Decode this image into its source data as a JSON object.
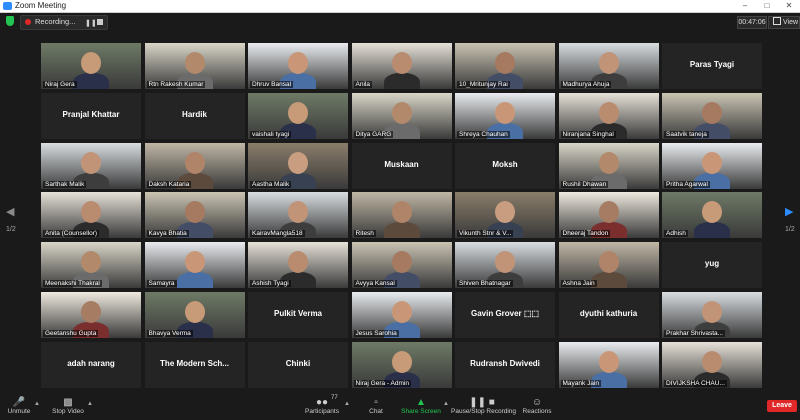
{
  "window": {
    "title": "Zoom Meeting"
  },
  "recording": {
    "label": "Recording...",
    "pause_icon": "pause-icon",
    "stop_icon": "stop-icon"
  },
  "meeting": {
    "elapsed": "00:47:06",
    "view_label": "View"
  },
  "pager": {
    "left_page": "1/2",
    "right_page": "1/2"
  },
  "participants": [
    {
      "name": "Niraj Gera",
      "video": true
    },
    {
      "name": "Rtn Rakesh Kumar",
      "video": true
    },
    {
      "name": "Dhruv Bansal",
      "video": true
    },
    {
      "name": "Anila",
      "video": true
    },
    {
      "name": "10_Mritunjay Rai",
      "video": true
    },
    {
      "name": "Madhurya Ahuja",
      "video": true
    },
    {
      "name": "Paras Tyagi",
      "video": false
    },
    {
      "name": "Pranjal Khattar",
      "video": false
    },
    {
      "name": "Hardik",
      "video": false
    },
    {
      "name": "vaishali tyagi",
      "video": true
    },
    {
      "name": "Ditya GARG",
      "video": true
    },
    {
      "name": "Shreya Chauhan",
      "video": true
    },
    {
      "name": "Niranjana Singhal",
      "video": true
    },
    {
      "name": "Saatvik taneja",
      "video": true
    },
    {
      "name": "Sarthak Malik",
      "video": true
    },
    {
      "name": "Daksh Kataria",
      "video": true
    },
    {
      "name": "Aastha Malik",
      "video": true
    },
    {
      "name": "Muskaan",
      "video": false
    },
    {
      "name": "Moksh",
      "video": false
    },
    {
      "name": "Rushil Dhawan",
      "video": true
    },
    {
      "name": "Pritha Agarwal",
      "video": true
    },
    {
      "name": "Anita (Counsellor)",
      "video": true
    },
    {
      "name": "Kavya Bhatia",
      "video": true
    },
    {
      "name": "KairavMangla518",
      "video": true
    },
    {
      "name": "Ritesh",
      "video": true
    },
    {
      "name": "Vikunth Stnr & V...",
      "video": true
    },
    {
      "name": "Dheeraj Tandon",
      "video": true
    },
    {
      "name": "Adhish",
      "video": true
    },
    {
      "name": "Meenakshi Thakral",
      "video": true
    },
    {
      "name": "Samayra",
      "video": true
    },
    {
      "name": "Ashish Tyagi",
      "video": true
    },
    {
      "name": "Avyya Kansal",
      "video": true
    },
    {
      "name": "Shiven Bhatnagar",
      "video": true
    },
    {
      "name": "Ashna Jain",
      "video": true
    },
    {
      "name": "yug",
      "video": false
    },
    {
      "name": "Geetanshu Gupta",
      "video": true
    },
    {
      "name": "Bhavya Verma",
      "video": true
    },
    {
      "name": "Pulkit Verma",
      "video": false
    },
    {
      "name": "Jesus Sarohia",
      "video": true
    },
    {
      "name": "Gavin Grover ⬚⬚",
      "video": false
    },
    {
      "name": "dyuthi kathuria",
      "video": false
    },
    {
      "name": "Prakhar Shrivasta...",
      "video": true
    },
    {
      "name": "adah narang",
      "video": false
    },
    {
      "name": "The Modern Sch...",
      "video": false
    },
    {
      "name": "Chinki",
      "video": false
    },
    {
      "name": "Niraj Gera - Admin",
      "video": true
    },
    {
      "name": "Rudransh Dwivedi",
      "video": false
    },
    {
      "name": "Mayank Jain",
      "video": true
    },
    {
      "name": "DIVIJKSHA CHAU...",
      "video": true
    }
  ],
  "toolbar": {
    "unmute": "Unmute",
    "stop_video": "Stop Video",
    "participants": "Participants",
    "participants_count": "77",
    "chat": "Chat",
    "share_screen": "Share Screen",
    "pause_stop_recording": "Pause/Stop Recording",
    "reactions": "Reactions",
    "leave": "Leave"
  },
  "colors": {
    "accent": "#2d8cff",
    "share_green": "#23c552",
    "leave_red": "#e02828",
    "active_speaker": "#c9d84b"
  }
}
